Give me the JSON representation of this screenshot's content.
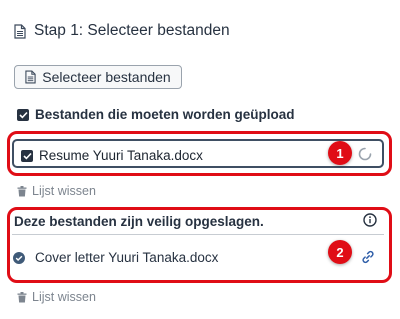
{
  "step": {
    "title": "Stap 1: Selecteer bestanden",
    "icon": "document-icon"
  },
  "select_button": {
    "label": "Selecteer bestanden",
    "icon": "document-icon"
  },
  "upload_section": {
    "label": "Bestanden die moeten worden geüpload",
    "checked": true,
    "files": [
      {
        "name": "Resume Yuuri Tanaka.docx",
        "checked": true,
        "status": "loading-spinner-icon"
      }
    ],
    "badge": "1",
    "clear_label": "Lijst wissen"
  },
  "saved_section": {
    "title": "Deze bestanden zijn veilig opgeslagen.",
    "info_icon": "info-icon",
    "files": [
      {
        "name": "Cover letter Yuuri Tanaka.docx",
        "status": "check-circle-icon",
        "action": "link-icon"
      }
    ],
    "badge": "2",
    "clear_label": "Lijst wissen"
  },
  "colors": {
    "accent_red": "#e00d16",
    "navy": "#273241",
    "check_blue": "#3f5a78",
    "link_blue": "#2f5ea8",
    "muted": "#7d858f"
  }
}
